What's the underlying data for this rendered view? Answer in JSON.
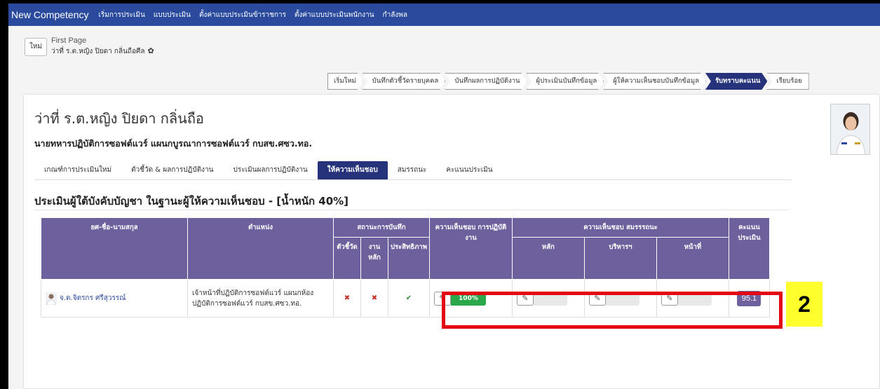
{
  "navbar": {
    "brand": "New Competency",
    "items": [
      "เริ่มการประเมิน",
      "แบบประเมิน",
      "ตั้งค่าแบบประเมินข้าราชการ",
      "ตั้งค่าแบบประเมินพนักงาน",
      "กำลังพล"
    ]
  },
  "breadcrumb": {
    "new_label": "ใหม่",
    "first_page": "First Page",
    "person": "ว่าที่ ร.ต.หญิง ปิยดา กลิ่นถือศีล"
  },
  "steps": [
    "เริ่มใหม่",
    "บันทึกตัวชี้วัดรายบุคคล",
    "บันทึกผลการปฏิบัติงาน",
    "ผู้ประเมินบันทึกข้อมูล",
    "ผู้ให้ความเห็นชอบบันทึกข้อมูล",
    "รับทราบคะแนน",
    "เรียบร้อย"
  ],
  "active_step": 5,
  "profile": {
    "name": "ว่าที่ ร.ต.หญิง ปิยดา กลิ่นถือ",
    "position": "นายทหารปฏิบัติการซอฟต์แวร์ แผนกบูรณาการซอฟต์แวร์ กบสข.ศซว.ทอ."
  },
  "tabs": [
    "เกณฑ์การประเมินใหม่",
    "ตัวชี้วัด & ผลการปฏิบัติงาน",
    "ประเมินผลการปฏิบัติงาน",
    "ให้ความเห็นชอบ",
    "สมรรถนะ",
    "คะแนนประเมิน"
  ],
  "active_tab": 3,
  "section_title": "ประเมินผู้ใต้บังคับบัญชา ในฐานะผู้ให้ความเห็นชอบ - [น้ำหนัก 40%]",
  "table": {
    "headers": {
      "name": "ยศ-ชื่อ-นามสกุล",
      "position": "ตำแหน่ง",
      "status": "สถานะการบันทึก",
      "perf": "ความเห็นชอบ การปฏิบัติงาน",
      "comp": "ความเห็นชอบ สมรรรถนะ",
      "score": "คะแนน ประเมิน",
      "status_sub": [
        "ตัวชี้วัด",
        "งานหลัก",
        "ประสิทธิภาพ"
      ],
      "comp_sub": [
        "หลัก",
        "บริหารฯ",
        "หน้าที่"
      ]
    },
    "rows": [
      {
        "name": "จ.ต.จิตรกร ศรีสุวรรณ์",
        "position": "เจ้าหน้าที่ปฏิบัติการซอฟต์แวร์ แผนกห้องปฏิบัติการซอฟต์แวร์ กบสข.ศซว.ทอ.",
        "status": [
          "✖",
          "✖",
          "✔"
        ],
        "perf_label": "100%",
        "perf_progress": 100,
        "comp_progress": [
          0,
          0,
          0
        ],
        "score": "95.1"
      }
    ]
  },
  "annotation": {
    "number": "2"
  },
  "colors": {
    "navbar": "#2a4a9e",
    "active": "#26337a",
    "table_header": "#6e5f9d",
    "progress": "#2aa84a",
    "highlight": "#e30613",
    "badge": "#ffff2e"
  }
}
